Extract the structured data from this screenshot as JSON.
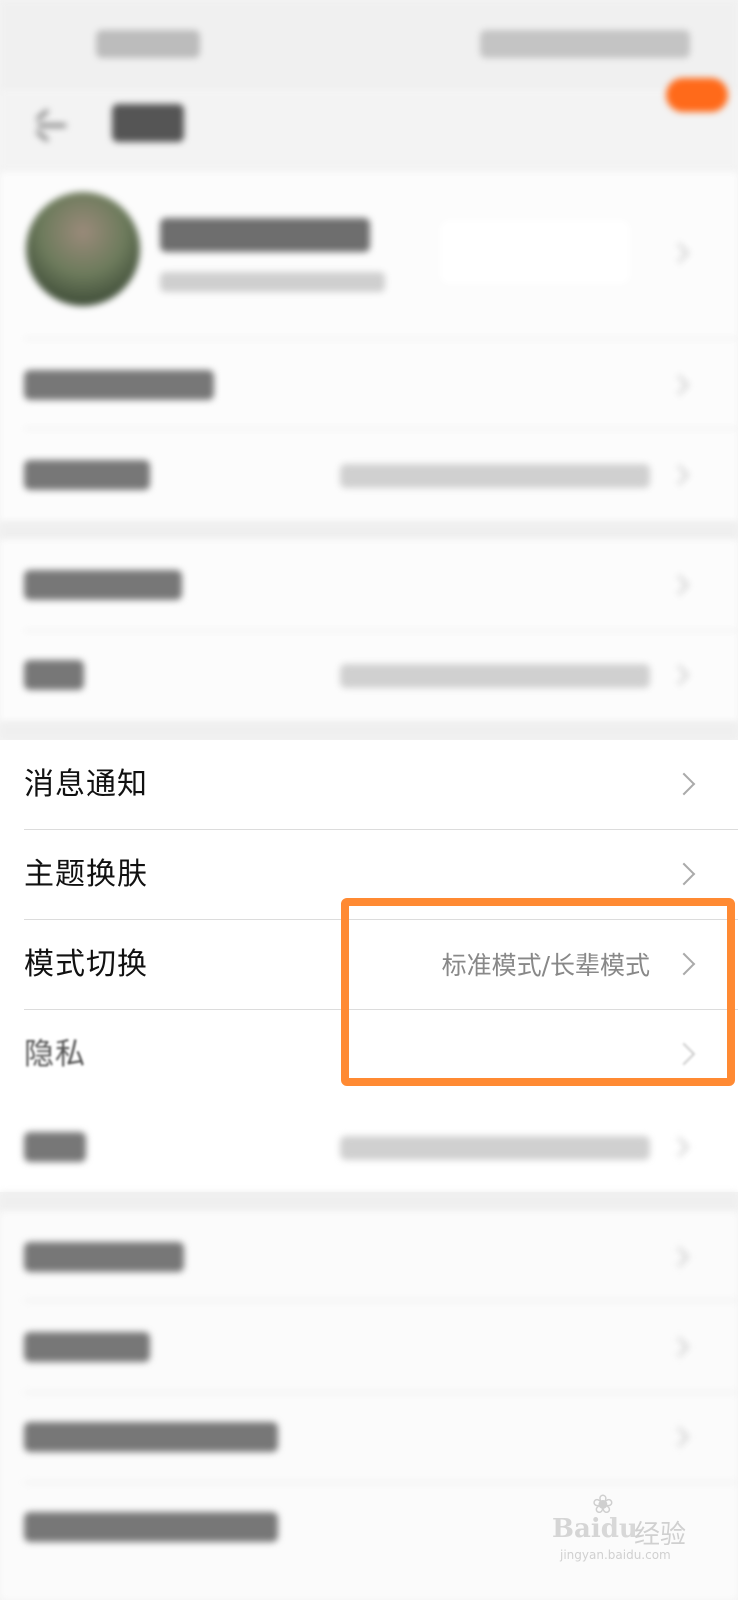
{
  "settings_group": {
    "rows": [
      {
        "label": "消息通知",
        "value": ""
      },
      {
        "label": "主题换肤",
        "value": ""
      },
      {
        "label": "模式切换",
        "value": "标准模式/长辈模式"
      },
      {
        "label": "隐私",
        "value": ""
      }
    ]
  },
  "watermark": {
    "brand": "Bai",
    "brand_accent": "du",
    "brand_suffix": "经验",
    "url": "jingyan.baidu.com"
  },
  "colors": {
    "highlight": "#ff8a33",
    "badge": "#ff6a1a"
  }
}
